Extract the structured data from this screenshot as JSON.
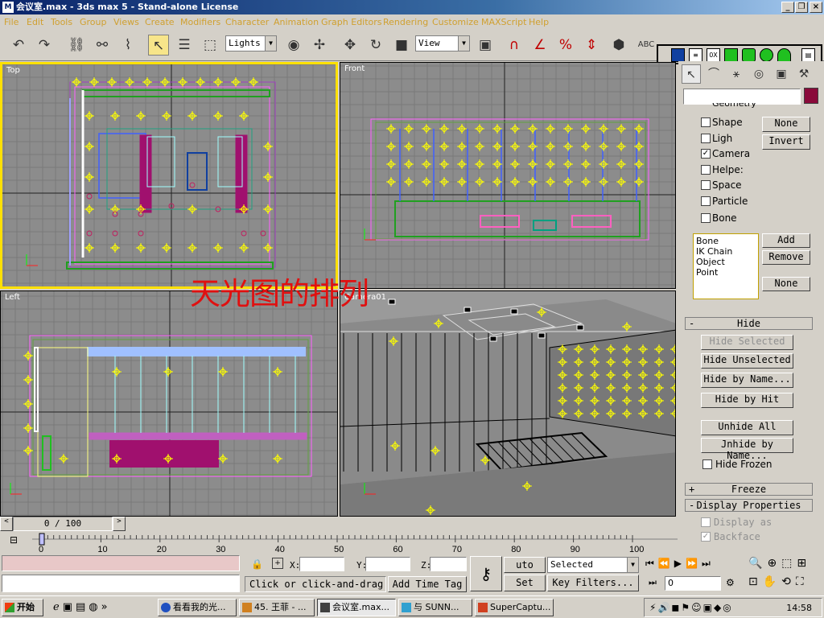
{
  "window": {
    "title": "会议室.max - 3ds max 5 - Stand-alone License"
  },
  "menu": [
    "File",
    "Edit",
    "Tools",
    "Group",
    "Views",
    "Create",
    "Modifiers",
    "Character",
    "Animation",
    "Graph Editors",
    "Rendering",
    "Customize",
    "MAXScript",
    "Help"
  ],
  "toolbar": {
    "selection_filter": "Lights",
    "reference_coord": "View"
  },
  "viewports": {
    "top": "Top",
    "front": "Front",
    "left": "Left",
    "camera": "Camera01"
  },
  "overlay_caption": "天光图的排列",
  "panel": {
    "partial_item": "Geometry",
    "filters": [
      {
        "label": "Shape",
        "checked": false
      },
      {
        "label": "Ligh",
        "checked": false
      },
      {
        "label": "Camera",
        "checked": true
      },
      {
        "label": "Helpe:",
        "checked": false
      },
      {
        "label": "Space",
        "checked": false
      },
      {
        "label": "Particle",
        "checked": false
      },
      {
        "label": "Bone",
        "checked": false
      }
    ],
    "none_btn": "None",
    "invert_btn": "Invert",
    "list_items": [
      "Bone",
      "IK Chain Object",
      "Point"
    ],
    "add_btn": "Add",
    "remove_btn": "Remove",
    "list_none_btn": "None",
    "hide_rollout": "Hide",
    "hide_sign": "-",
    "hide_selected": "Hide Selected",
    "hide_unselected": "Hide Unselected",
    "hide_by_name": "Hide by Name...",
    "hide_by_hit": "Hide by Hit",
    "unhide_all": "Unhide All",
    "unhide_by_name": "Jnhide by Name...",
    "hide_frozen": "Hide Frozen",
    "freeze_rollout": "Freeze",
    "freeze_sign": "+",
    "display_props": "Display Properties",
    "display_sign": "-",
    "display_as": "Display as",
    "backface": "Backface"
  },
  "timeslider": {
    "label": "0 / 100"
  },
  "trackbar": {
    "ticks": [
      "0",
      "10",
      "20",
      "30",
      "40",
      "50",
      "60",
      "70",
      "80",
      "90",
      "100"
    ]
  },
  "status": {
    "x_label": "X:",
    "y_label": "Y:",
    "z_label": "Z:",
    "prompt": "Click or click-and-drag",
    "add_time_tag": "Add Time Tag",
    "auto_key": "uto Key",
    "set_key": "Set Key",
    "key_mode": "Selected",
    "key_filters": "Key Filters...",
    "frame": "0"
  },
  "taskbar": {
    "start": "开始",
    "tasks": [
      "看看我的光...",
      "45. 王菲 - ...",
      "会议室.max...",
      "与 SUNN...",
      "SuperCaptu..."
    ],
    "clock": "14:58"
  },
  "colors": {
    "viewport_bg": "#8c8c8c",
    "active_border": "#ffe000",
    "light": "#ffff00",
    "furniture": "#a0106e",
    "caption": "#e01010"
  }
}
